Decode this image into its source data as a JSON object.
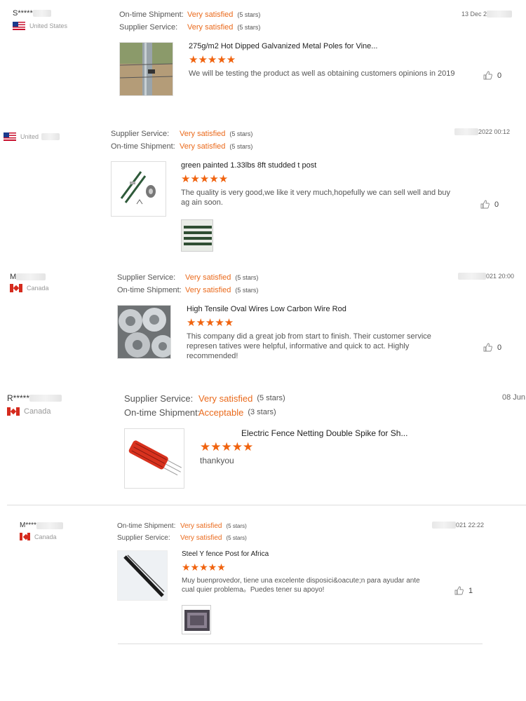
{
  "reviews": [
    {
      "user": "S*****",
      "country": "United States",
      "flag": "us",
      "rating1": {
        "label": "On-time Shipment:",
        "value": "Very satisfied",
        "stars": "(5 stars)"
      },
      "rating2": {
        "label": "Supplier Service:",
        "value": "Very satisfied",
        "stars": "(5 stars)"
      },
      "date": "13 Dec 2",
      "product": "275g/m2 Hot Dipped Galvanized Metal Poles for Vine...",
      "star_glyphs": "★★★★★",
      "text": "We will be testing the product as well as obtaining customers opinions in 2019",
      "likes": "0"
    },
    {
      "user": "",
      "country": "United",
      "flag": "us",
      "rating1": {
        "label": "Supplier Service:",
        "value": "Very satisfied",
        "stars": "(5 stars)"
      },
      "rating2": {
        "label": "On-time Shipment:",
        "value": "Very satisfied",
        "stars": "(5 stars)"
      },
      "date": "2022 00:12",
      "product": "green painted 1.33lbs 8ft studded t post",
      "star_glyphs": "★★★★★",
      "text": "The quality is very good,we like it very much,hopefully we can sell well and buy ag ain soon.",
      "likes": "0"
    },
    {
      "user": "M",
      "country": "Canada",
      "flag": "ca",
      "rating1": {
        "label": "Supplier Service:",
        "value": "Very satisfied",
        "stars": "(5 stars)"
      },
      "rating2": {
        "label": "On-time Shipment:",
        "value": "Very satisfied",
        "stars": "(5 stars)"
      },
      "date": "021 20:00",
      "product": "High Tensile Oval Wires Low Carbon Wire Rod",
      "star_glyphs": "★★★★★",
      "text": "This company did a great job from start to finish. Their customer service represen tatives were helpful,  informative and quick to act.  Highly recommended!",
      "likes": "0"
    },
    {
      "user": "R*****",
      "country": "Canada",
      "flag": "ca",
      "rating1": {
        "label": "Supplier Service:",
        "value": "Very satisfied",
        "stars": "(5 stars)"
      },
      "rating2": {
        "label": "On-time Shipment:",
        "value": "Acceptable",
        "stars": "(3 stars)"
      },
      "date": "08 Jun",
      "product": "Electric Fence Netting Double Spike for Sh...",
      "star_glyphs": "★★★★★",
      "text": "thankyou",
      "likes": ""
    },
    {
      "user": "M****",
      "country": "Canada",
      "flag": "ca",
      "rating1": {
        "label": "On-time Shipment:",
        "value": "Very satisfied",
        "stars": "(5 stars)"
      },
      "rating2": {
        "label": "Supplier Service:",
        "value": "Very satisfied",
        "stars": "(5 stars)"
      },
      "date": "021 22:22",
      "product": "Steel Y fence Post for Africa",
      "star_glyphs": "★★★★★",
      "text": "Muy buenprovedor, tiene una excelente disposici&oacute;n para ayudar ante cual quier problema。Puedes tener su apoyo!",
      "likes": "1"
    }
  ],
  "colors": {
    "accent": "#ea6a1c",
    "star": "#f0630f"
  }
}
